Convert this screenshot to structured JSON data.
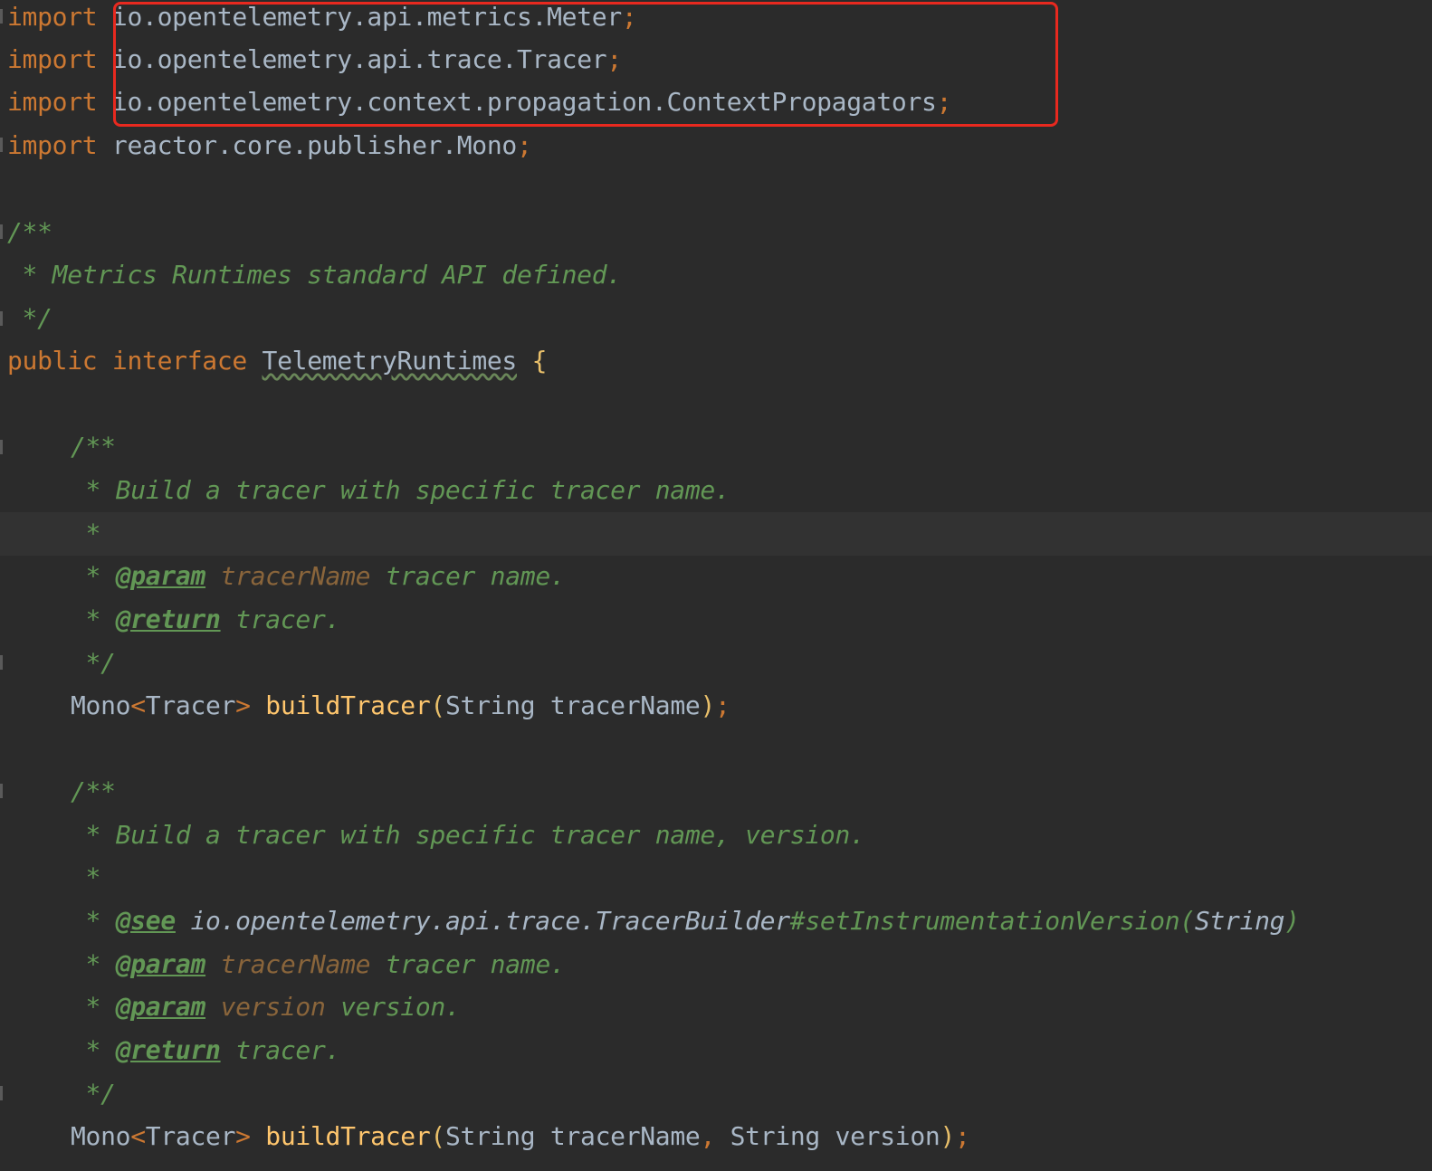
{
  "imports": [
    {
      "keyword": "import",
      "path": "io.opentelemetry.api.metrics.Meter",
      "semicolon": ";"
    },
    {
      "keyword": "import",
      "path": "io.opentelemetry.api.trace.Tracer",
      "semicolon": ";"
    },
    {
      "keyword": "import",
      "path": "io.opentelemetry.context.propagation.ContextPropagators",
      "semicolon": ";"
    },
    {
      "keyword": "import",
      "path": "reactor.core.publisher.Mono",
      "semicolon": ";"
    }
  ],
  "class_doc": {
    "open": "/**",
    "line": " * Metrics Runtimes standard API defined.",
    "close": " */"
  },
  "declaration": {
    "modifier": "public",
    "keyword": "interface",
    "name": "TelemetryRuntimes",
    "brace": "{"
  },
  "method1": {
    "doc_open": "/**",
    "doc_desc": " * Build a tracer with specific tracer name.",
    "doc_blank": " *",
    "star": " * ",
    "param_tag": "@param",
    "param_name": "tracerName",
    "param_desc": " tracer name.",
    "return_tag": "@return",
    "return_desc": " tracer.",
    "doc_close": " */",
    "return_type": "Mono",
    "lt": "<",
    "generic": "Tracer",
    "gt": ">",
    "name": "buildTracer",
    "paren_open": "(",
    "param_type": "String",
    "param_var": "tracerName",
    "paren_close": ")",
    "semicolon": ";"
  },
  "method2": {
    "doc_open": "/**",
    "doc_desc": " * Build a tracer with specific tracer name, version.",
    "doc_blank": " *",
    "star": " * ",
    "see_tag": "@see",
    "see_ref": "io.opentelemetry.api.trace.TracerBuilder",
    "see_member": "#setInstrumentationVersion(",
    "see_arg": "String",
    "see_close": ")",
    "param1_tag": "@param",
    "param1_name": "tracerName",
    "param1_desc": " tracer name.",
    "param2_tag": "@param",
    "param2_name": "version",
    "param2_desc": " version.",
    "return_tag": "@return",
    "return_desc": " tracer.",
    "doc_close": " */",
    "return_type": "Mono",
    "lt": "<",
    "generic": "Tracer",
    "gt": ">",
    "name": "buildTracer",
    "paren_open": "(",
    "param1_type": "String",
    "param1_var": "tracerName",
    "comma": ",",
    "param2_type": "String",
    "param2_var": "version",
    "paren_close": ")",
    "semicolon": ";"
  },
  "colors": {
    "background": "#2b2b2b",
    "keyword": "#cc7832",
    "doc_comment": "#629755",
    "method_name": "#ffc66d",
    "identifier": "#a9b7c6",
    "highlight_box": "#e8291f"
  }
}
